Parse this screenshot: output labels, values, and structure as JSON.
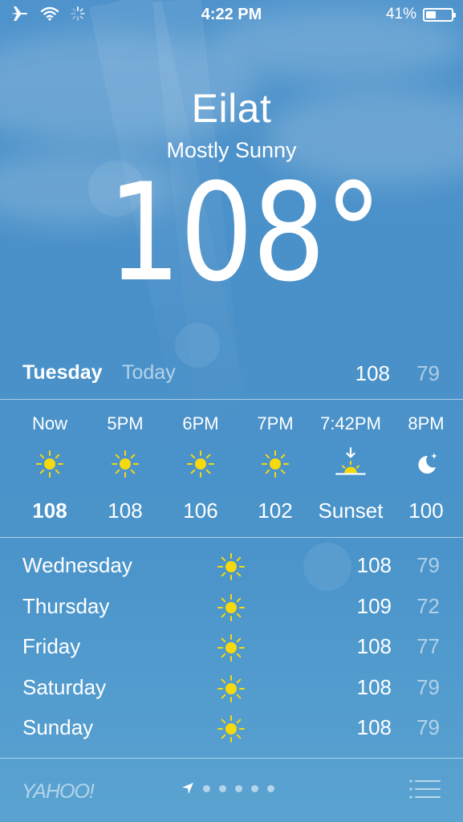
{
  "status_bar": {
    "time": "4:22 PM",
    "battery_percent_text": "41%",
    "battery_level": 0.41,
    "icons": [
      "airplane-icon",
      "wifi-icon",
      "activity-spinner-icon"
    ]
  },
  "header": {
    "city": "Eilat",
    "condition": "Mostly Sunny",
    "temperature": "108°"
  },
  "today": {
    "day": "Tuesday",
    "label": "Today",
    "high": "108",
    "low": "79"
  },
  "hourly": [
    {
      "time": "Now",
      "icon": "sun-icon",
      "value": "108"
    },
    {
      "time": "5PM",
      "icon": "sun-icon",
      "value": "108"
    },
    {
      "time": "6PM",
      "icon": "sun-icon",
      "value": "106"
    },
    {
      "time": "7PM",
      "icon": "sun-icon",
      "value": "102"
    },
    {
      "time": "7:42PM",
      "icon": "sunset-icon",
      "value": "Sunset"
    },
    {
      "time": "8PM",
      "icon": "moon-icon",
      "value": "100"
    }
  ],
  "daily": [
    {
      "day": "Wednesday",
      "icon": "sun-icon",
      "high": "108",
      "low": "79"
    },
    {
      "day": "Thursday",
      "icon": "sun-icon",
      "high": "109",
      "low": "72"
    },
    {
      "day": "Friday",
      "icon": "sun-icon",
      "high": "108",
      "low": "77"
    },
    {
      "day": "Saturday",
      "icon": "sun-icon",
      "high": "108",
      "low": "79"
    },
    {
      "day": "Sunday",
      "icon": "sun-icon",
      "high": "108",
      "low": "79"
    }
  ],
  "footer": {
    "brand": "YAHOO!",
    "page_indicator_icons": [
      "location-arrow-icon",
      "dot",
      "dot",
      "dot",
      "dot",
      "dot"
    ],
    "list_icon": "list-icon"
  },
  "colors": {
    "sky": "#4b93cb",
    "sun": "#f5d90f",
    "secondary_text": "rgba(255,255,255,0.55)"
  }
}
